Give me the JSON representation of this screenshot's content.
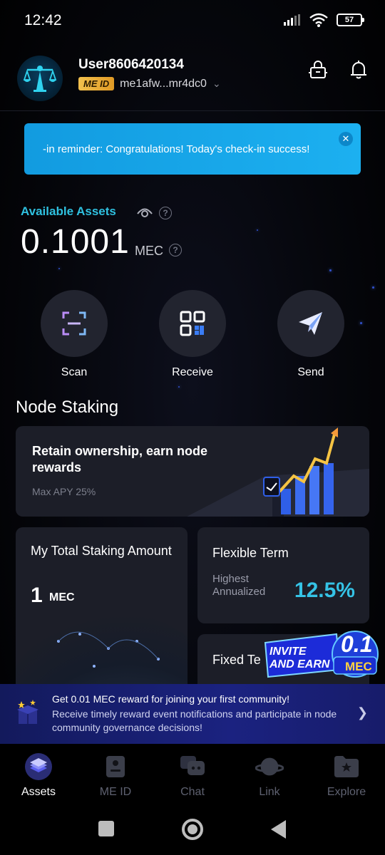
{
  "status_bar": {
    "time": "12:42",
    "battery": "57"
  },
  "header": {
    "username": "User8606420134",
    "me_id_badge": "ME ID",
    "address": "me1afw...mr4dc0"
  },
  "banner": {
    "text": "-in reminder: Congratulations! Today's check-in success!"
  },
  "assets": {
    "label": "Available Assets",
    "balance": "0.1001",
    "unit": "MEC"
  },
  "actions": [
    {
      "label": "Scan",
      "icon": "scan-icon"
    },
    {
      "label": "Receive",
      "icon": "qr-code-icon"
    },
    {
      "label": "Send",
      "icon": "paper-plane-icon"
    }
  ],
  "node_staking": {
    "title": "Node Staking",
    "hero": {
      "title": "Retain ownership, earn node rewards",
      "subtitle": "Max APY 25%"
    },
    "my_total": {
      "title": "My Total Staking Amount",
      "amount": "1",
      "unit": "MEC"
    },
    "flexible": {
      "title": "Flexible Term",
      "label": "Highest Annualized",
      "value": "12.5%"
    },
    "fixed": {
      "title": "Fixed Te"
    }
  },
  "invite": {
    "line1": "INVITE",
    "line2": "AND EARN",
    "amount": "0.1",
    "unit": "MEC"
  },
  "community": {
    "title": "Get 0.01 MEC reward for joining your first community!",
    "subtitle": "Receive timely reward event notifications and participate in node community governance decisions!"
  },
  "nav": [
    {
      "label": "Assets",
      "active": true
    },
    {
      "label": "ME ID",
      "active": false
    },
    {
      "label": "Chat",
      "active": false
    },
    {
      "label": "Link",
      "active": false
    },
    {
      "label": "Explore",
      "active": false
    }
  ],
  "colors": {
    "accent_cyan": "#35c3e6",
    "banner_blue": "#1cb0f0",
    "card_bg": "#1c1e28",
    "meid_gold": "#f2c14e"
  }
}
